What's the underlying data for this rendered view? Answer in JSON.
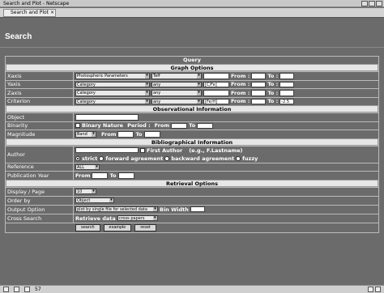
{
  "window": {
    "title": "Search and Plot - Netscape"
  },
  "tab": {
    "label": "Search and Plot"
  },
  "page": {
    "title": "Search"
  },
  "query": {
    "heading": "Query"
  },
  "graph": {
    "heading": "Graph Options",
    "from": "From :",
    "to": "To :",
    "xaxis": {
      "label": "Xaxis",
      "category": "Photospheric Parameters",
      "param": "Teff",
      "unit": ""
    },
    "yaxis": {
      "label": "Yaxis",
      "category": "Category",
      "param": "any",
      "unit": "[C/Fe]"
    },
    "zaxis": {
      "label": "Zaxis",
      "category": "Category",
      "param": "any",
      "unit": ""
    },
    "criterion": {
      "label": "Criterion",
      "category": "Category",
      "param": "any",
      "unit": "[Fe/H]",
      "to_value": "-2.5"
    }
  },
  "observational": {
    "heading": "Observational Information",
    "object_label": "Object",
    "binarity_label": "Binarity",
    "binary_nature": "Binary Nature",
    "period": "Period :",
    "from": "From",
    "to": "To",
    "magnitude_label": "Magnitude",
    "band": "Band",
    "mag_from": "From",
    "mag_to": "To"
  },
  "bibliographical": {
    "heading": "Bibliographical Information",
    "author_label": "Author",
    "first_author": "First Author",
    "example": "(e.g., F.Lastname)",
    "strict": "strict",
    "forward": "forward agreement",
    "backward": "backward agreement",
    "fuzzy": "fuzzy",
    "reference_label": "Reference",
    "reference_value": "ALL",
    "pubyear_label": "Publication Year",
    "from": "From",
    "to": "To"
  },
  "retrieval": {
    "heading": "Retrieval Options",
    "display_label": "Display / Page",
    "display_value": "10",
    "order_label": "Order by",
    "order_value": "Object",
    "output_label": "Output Option",
    "output_value": "plot by single file for selected data",
    "bin_width": "Bin Width",
    "cross_label": "Cross Search",
    "retrieve_data": "Retrieve data",
    "cross_value": "cross papers"
  },
  "buttons": {
    "search": "search",
    "example": "example",
    "reset": "reset"
  },
  "status": {
    "count": "57"
  }
}
